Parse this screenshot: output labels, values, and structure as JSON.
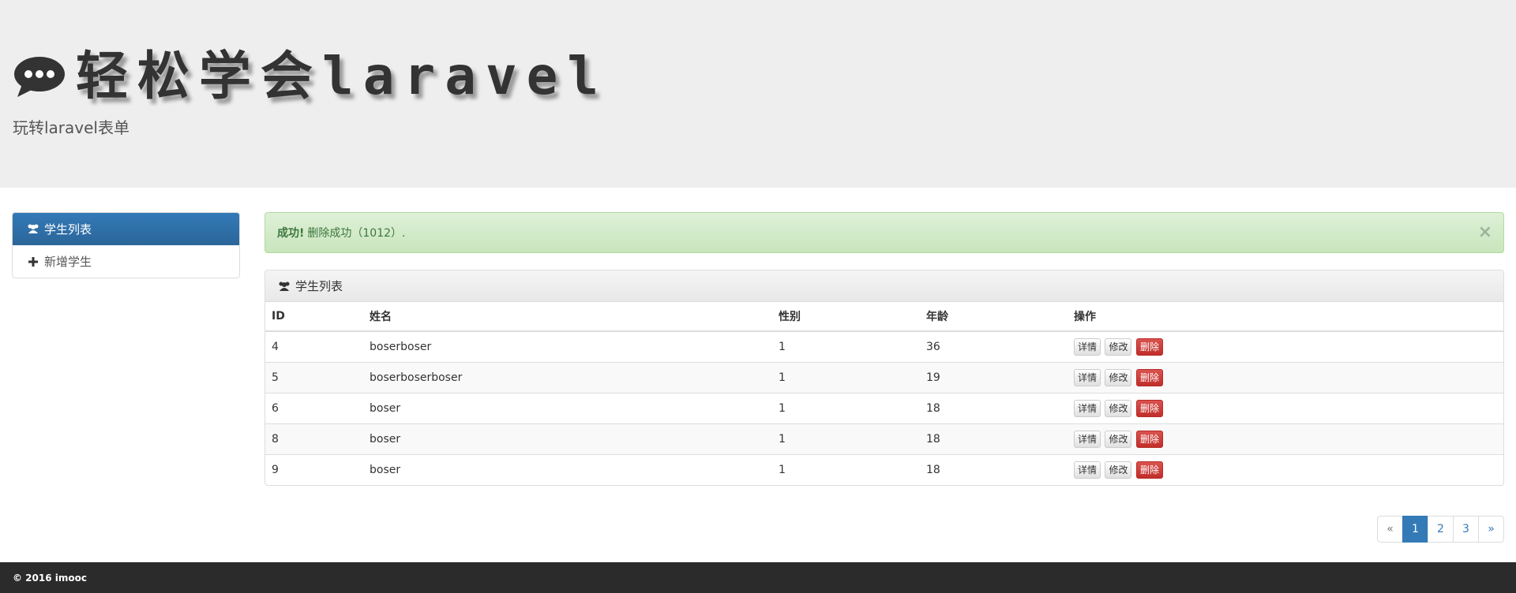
{
  "header": {
    "title": "轻松学会laravel",
    "subtitle": "玩转laravel表单",
    "icon": "comment-icon"
  },
  "sidebar": {
    "items": [
      {
        "label": "学生列表",
        "icon": "users-icon",
        "active": true
      },
      {
        "label": "新增学生",
        "icon": "plus-icon",
        "active": false
      }
    ]
  },
  "alert": {
    "strong": "成功!",
    "message": "删除成功（1012）.",
    "close": "×"
  },
  "panel": {
    "title": "学生列表",
    "icon": "users-icon"
  },
  "table": {
    "headers": [
      "ID",
      "姓名",
      "性别",
      "年龄",
      "操作"
    ],
    "rows": [
      {
        "id": "4",
        "name": "boserboser",
        "sex": "1",
        "age": "36"
      },
      {
        "id": "5",
        "name": "boserboserboser",
        "sex": "1",
        "age": "19"
      },
      {
        "id": "6",
        "name": "boser",
        "sex": "1",
        "age": "18"
      },
      {
        "id": "8",
        "name": "boser",
        "sex": "1",
        "age": "18"
      },
      {
        "id": "9",
        "name": "boser",
        "sex": "1",
        "age": "18"
      }
    ],
    "actions": {
      "detail": "详情",
      "edit": "修改",
      "delete": "删除"
    }
  },
  "pagination": {
    "prev": "«",
    "pages": [
      "1",
      "2",
      "3"
    ],
    "current": "1",
    "next": "»"
  },
  "footer": {
    "text": "© 2016 imooc"
  },
  "colors": {
    "primary": "#337ab7",
    "success_bg": "#dff0d8",
    "danger": "#d9534f",
    "footer_bg": "#2b2b2b"
  }
}
